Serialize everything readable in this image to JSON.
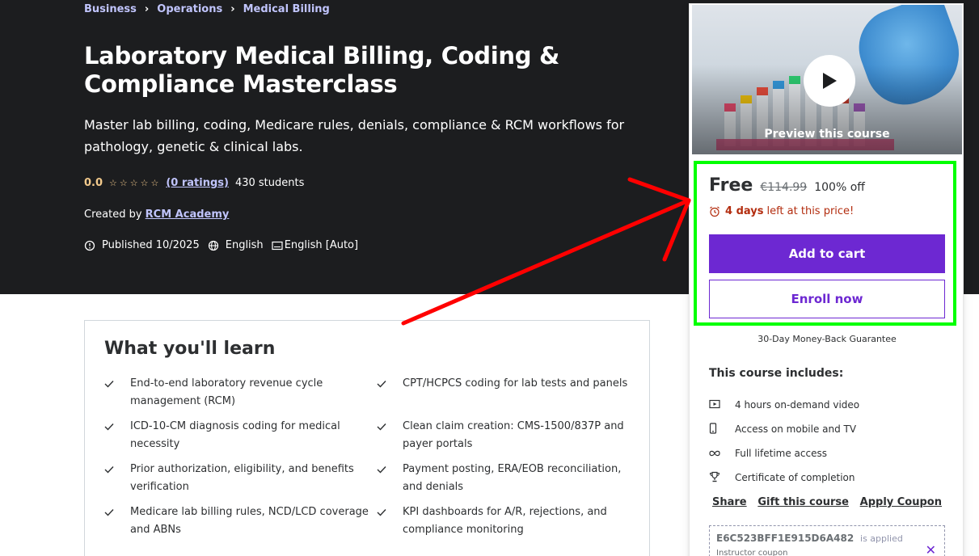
{
  "breadcrumb": [
    {
      "label": "Business"
    },
    {
      "label": "Operations"
    },
    {
      "label": "Medical Billing"
    }
  ],
  "course": {
    "title": "Laboratory Medical Billing, Coding & Compliance Masterclass",
    "subtitle": "Master lab billing, coding, Medicare rules, denials, compliance & RCM workflows for pathology, genetic & clinical labs.",
    "rating": "0.0",
    "ratings_link": "(0 ratings)",
    "students": "430 students",
    "created_by_label": "Created by",
    "instructor": "RCM Academy",
    "published": "Published 10/2025",
    "language": "English",
    "captions": "English [Auto]"
  },
  "learn": {
    "title": "What you'll learn",
    "items": [
      "End-to-end laboratory revenue cycle management (RCM)",
      "CPT/HCPCS coding for lab tests and panels",
      "ICD-10-CM diagnosis coding for medical necessity",
      "Clean claim creation: CMS-1500/837P and payer portals",
      "Prior authorization, eligibility, and benefits verification",
      "Payment posting, ERA/EOB reconciliation, and denials",
      "Medicare lab billing rules, NCD/LCD coverage and ABNs",
      "KPI dashboards for A/R, rejections, and compliance monitoring"
    ]
  },
  "sidebar": {
    "preview_label": "Preview this course",
    "price": "Free",
    "original_price": "€114.99",
    "discount": "100% off",
    "timer_days": "4 days",
    "timer_rest": "left at this price!",
    "add_to_cart": "Add to cart",
    "enroll_now": "Enroll now",
    "guarantee": "30-Day Money-Back Guarantee",
    "includes_title": "This course includes:",
    "includes": [
      {
        "icon": "video-icon",
        "label": "4 hours on-demand video"
      },
      {
        "icon": "mobile-icon",
        "label": "Access on mobile and TV"
      },
      {
        "icon": "infinity-icon",
        "label": "Full lifetime access"
      },
      {
        "icon": "trophy-icon",
        "label": "Certificate of completion"
      }
    ],
    "share": "Share",
    "gift": "Gift this course",
    "apply_coupon": "Apply Coupon",
    "coupon_code": "E6C523BFF1E915D6A482",
    "coupon_applied": "is applied",
    "coupon_sub": "Instructor coupon"
  },
  "colors": {
    "hero_bg": "#1c1d1f",
    "accent_purple": "#6d28d2",
    "link_lilac": "#c0c4fc",
    "star_gold": "#f3ca8c",
    "timer_red": "#b32d0f",
    "highlight_green": "#00ff00",
    "arrow_red": "#ff0000"
  }
}
